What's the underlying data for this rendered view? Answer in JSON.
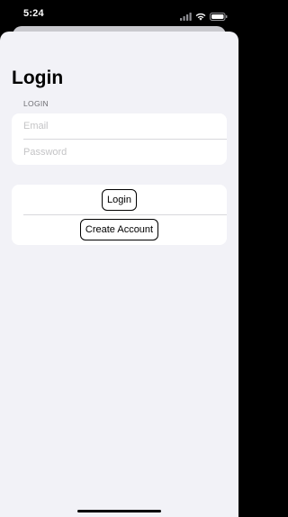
{
  "status_bar": {
    "time": "5:24",
    "icons": [
      "cellular-icon",
      "wifi-icon",
      "battery-icon"
    ]
  },
  "nav": {
    "title": "Login"
  },
  "form": {
    "section_header": "LOGIN",
    "email_placeholder": "Email",
    "email_value": "",
    "password_placeholder": "Password",
    "password_value": ""
  },
  "actions": {
    "login_label": "Login",
    "create_account_label": "Create Account"
  },
  "colors": {
    "background": "#f2f2f7",
    "card": "#ffffff",
    "placeholder": "#c4c4c6",
    "section_header": "#6d6d72"
  }
}
